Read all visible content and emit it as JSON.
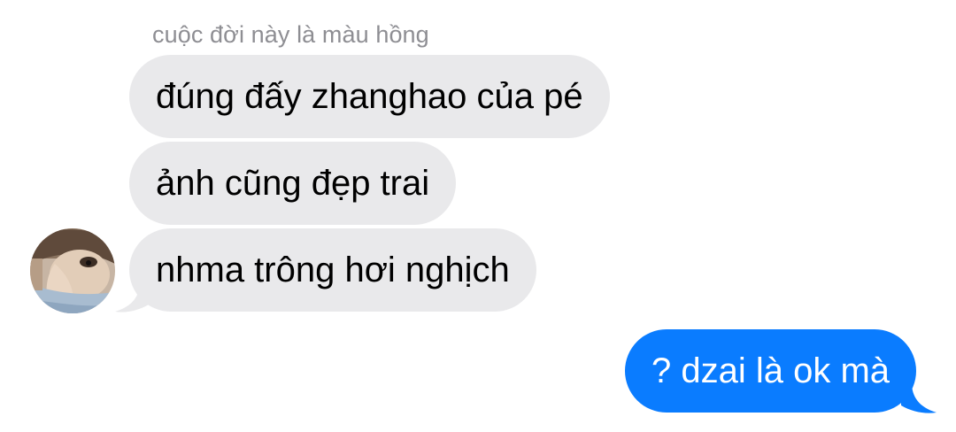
{
  "conversation": {
    "sender_name": "cuộc đời này là màu hồng",
    "incoming_messages": [
      {
        "text": "đúng đấy zhanghao của pé"
      },
      {
        "text": "ảnh cũng đẹp trai"
      },
      {
        "text": "nhma trông hơi nghịch"
      }
    ],
    "outgoing_messages": [
      {
        "text": "? dzai là ok mà"
      }
    ]
  },
  "colors": {
    "incoming_bubble": "#e9e9eb",
    "outgoing_bubble": "#0a7cff",
    "sender_name_text": "#8e8e93"
  },
  "icons": {
    "avatar": "contact-avatar-photo"
  }
}
